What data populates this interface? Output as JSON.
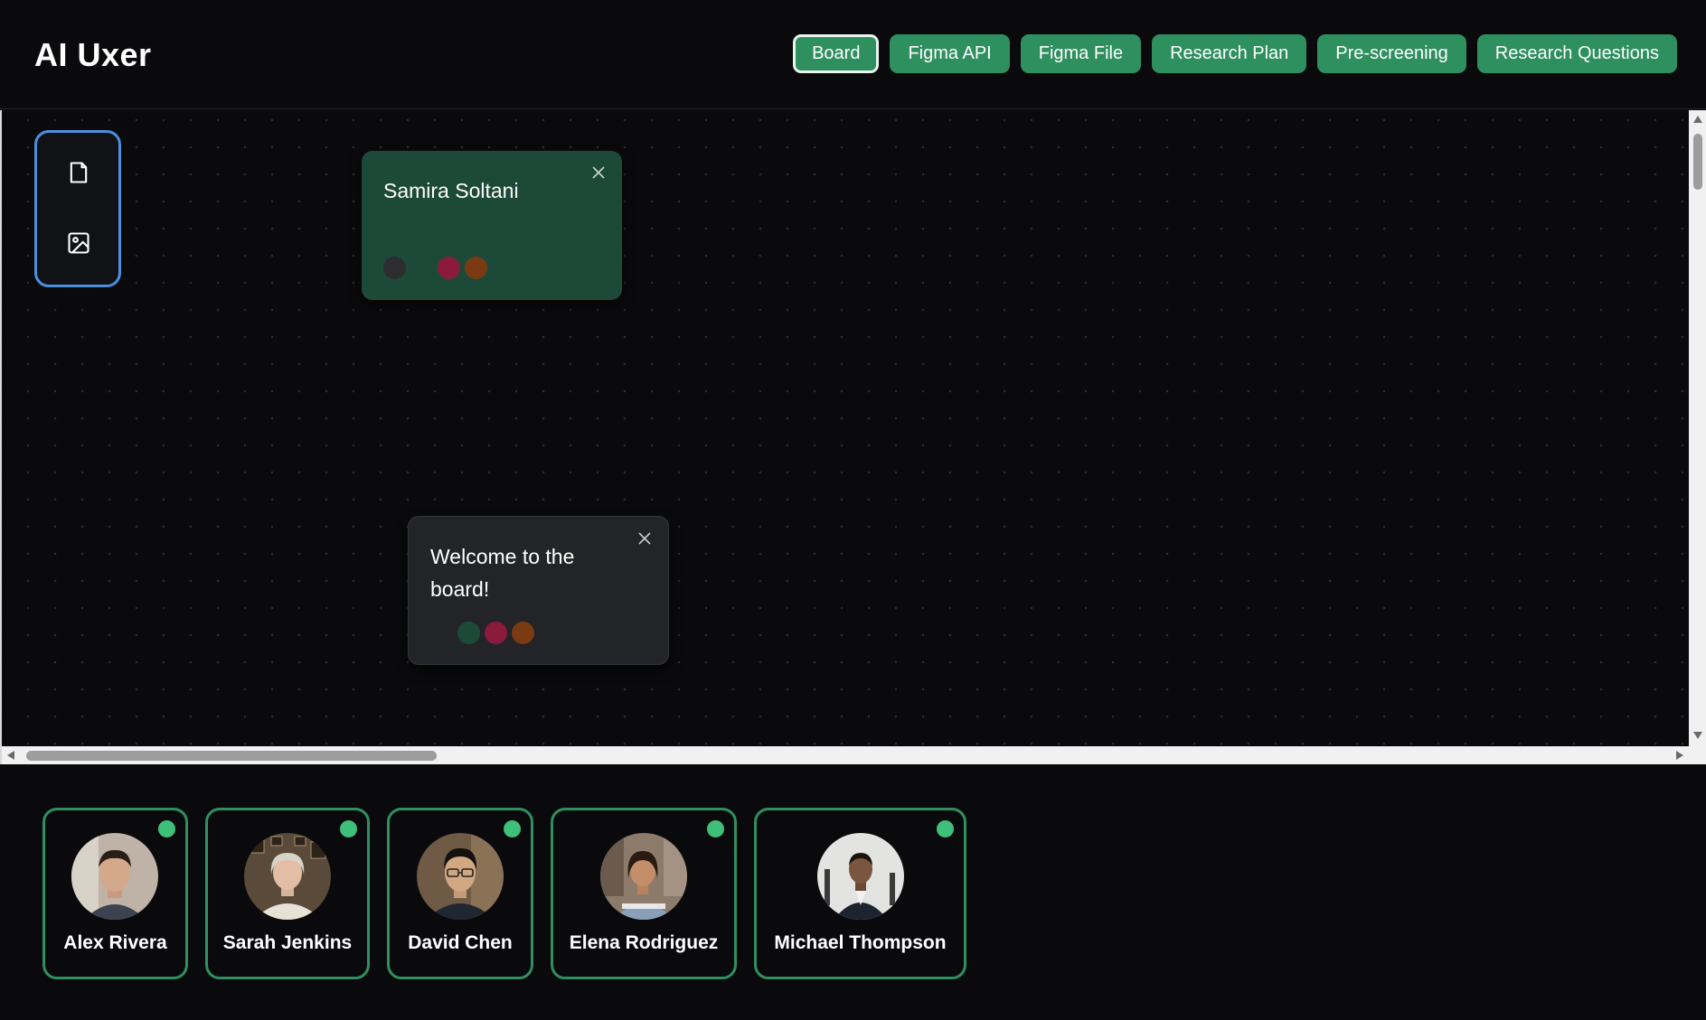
{
  "app": {
    "title": "AI Uxer"
  },
  "nav": {
    "items": [
      {
        "label": "Board",
        "active": true
      },
      {
        "label": "Figma API",
        "active": false
      },
      {
        "label": "Figma File",
        "active": false
      },
      {
        "label": "Research Plan",
        "active": false
      },
      {
        "label": "Pre-screening",
        "active": false
      },
      {
        "label": "Research Questions",
        "active": false
      }
    ]
  },
  "toolbar": {
    "tools": [
      "file-icon",
      "image-icon"
    ]
  },
  "notes": [
    {
      "text": "Samira Soltani",
      "color": "#1d4a38",
      "swatches": [
        "#2d2d30",
        "#8a1b3d",
        "#7a3b12"
      ]
    },
    {
      "text": "Welcome to the board!",
      "color": "#232427",
      "swatches": [
        "#1d4a38",
        "#8a1b3d",
        "#7a3b12"
      ]
    }
  ],
  "participants": [
    {
      "name": "Alex Rivera",
      "online": true
    },
    {
      "name": "Sarah Jenkins",
      "online": true
    },
    {
      "name": "David Chen",
      "online": true
    },
    {
      "name": "Elena Rodriguez",
      "online": true
    },
    {
      "name": "Michael Thompson",
      "online": true
    }
  ],
  "colors": {
    "accent": "#2e8f5f",
    "online": "#3fc07a",
    "toolbar_border": "#4a8fe0"
  }
}
